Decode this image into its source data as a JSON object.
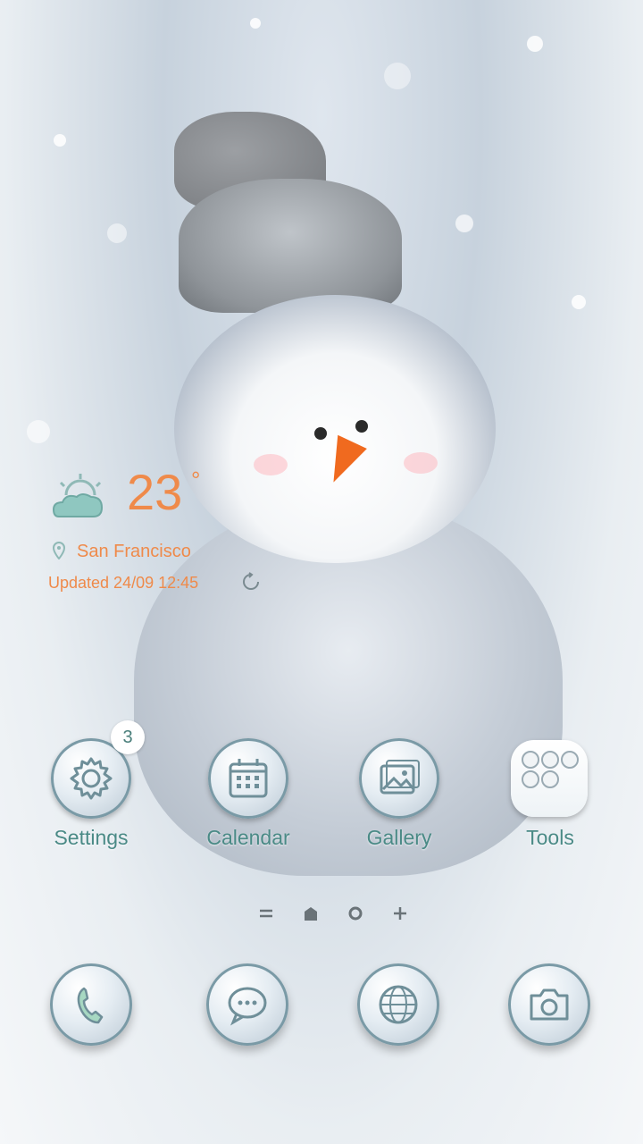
{
  "weather": {
    "temperature": "23",
    "degree_symbol": "°",
    "city": "San Francisco",
    "updated": "Updated 24/09 12:45",
    "condition_icon": "partly-cloudy-icon"
  },
  "apps": [
    {
      "label": "Settings",
      "icon": "gear-icon",
      "badge": "3"
    },
    {
      "label": "Calendar",
      "icon": "calendar-icon"
    },
    {
      "label": "Gallery",
      "icon": "image-icon"
    },
    {
      "label": "Tools",
      "icon": "folder-grid-icon"
    }
  ],
  "page_indicators": [
    "menu-icon",
    "home-icon",
    "circle-icon",
    "plus-icon"
  ],
  "dock": [
    {
      "icon": "phone-icon"
    },
    {
      "icon": "message-icon"
    },
    {
      "icon": "globe-icon"
    },
    {
      "icon": "camera-icon"
    }
  ],
  "colors": {
    "accent_orange": "#ef8a4a",
    "label_teal": "#4a8a86",
    "icon_ring": "#7a9aa6"
  }
}
